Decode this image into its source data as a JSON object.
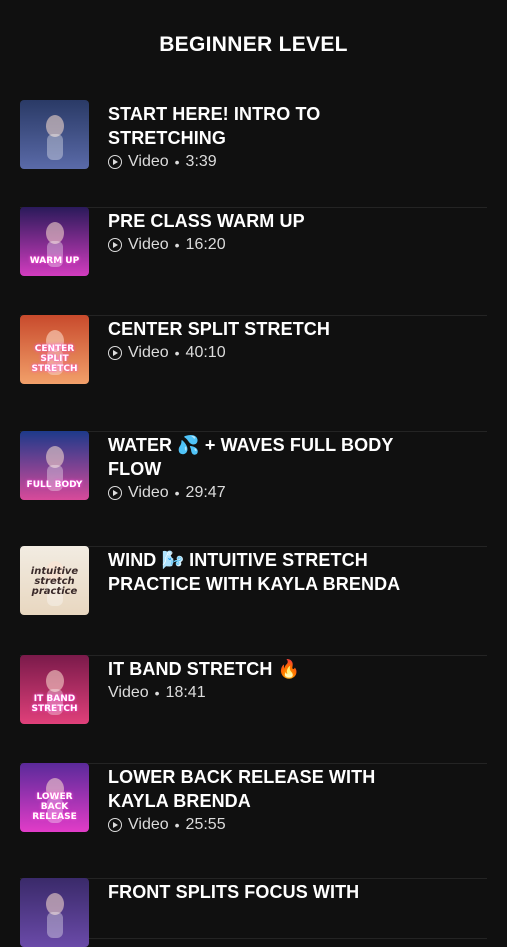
{
  "header": {
    "title": "BEGINNER LEVEL"
  },
  "items": [
    {
      "title": "START HERE! INTRO TO STRETCHING",
      "type": "Video",
      "duration": "3:39",
      "show_play": true,
      "thumb_text": "",
      "thumb_colors": [
        "#2a3a66",
        "#5a6aa8"
      ]
    },
    {
      "title": "PRE CLASS WARM UP",
      "type": "Video",
      "duration": "16:20",
      "show_play": true,
      "thumb_text": "WARM UP",
      "thumb_colors": [
        "#2a1a5a",
        "#d23cbf"
      ]
    },
    {
      "title": "CENTER SPLIT STRETCH",
      "type": "Video",
      "duration": "40:10",
      "show_play": true,
      "thumb_text": "CENTER SPLIT STRETCH",
      "thumb_colors": [
        "#c84a2c",
        "#f2a06a"
      ]
    },
    {
      "title": "WATER 💦 + WAVES FULL BODY FLOW",
      "type": "Video",
      "duration": "29:47",
      "show_play": true,
      "thumb_text": "FULL BODY",
      "thumb_colors": [
        "#1d3a8a",
        "#d84a9a"
      ]
    },
    {
      "title": "WIND 🌬️ INTUITIVE STRETCH PRACTICE WITH KAYLA BRENDA",
      "type": "",
      "duration": "",
      "show_play": false,
      "thumb_text": "intuitive stretch practice",
      "thumb_colors": [
        "#f2ece2",
        "#e8d7c0"
      ]
    },
    {
      "title": "IT BAND STRETCH 🔥",
      "type": "Video",
      "duration": "18:41",
      "show_play": false,
      "thumb_text": "IT BAND STRETCH",
      "thumb_colors": [
        "#7a1a4a",
        "#e0407a"
      ]
    },
    {
      "title": "LOWER BACK RELEASE WITH KAYLA BRENDA",
      "type": "Video",
      "duration": "25:55",
      "show_play": true,
      "thumb_text": "LOWER BACK RELEASE",
      "thumb_colors": [
        "#5a2a9a",
        "#e23cc8"
      ]
    },
    {
      "title": "FRONT SPLITS FOCUS WITH",
      "type": "",
      "duration": "",
      "show_play": false,
      "thumb_text": "",
      "thumb_colors": [
        "#3a2a6a",
        "#6a4aa8"
      ]
    }
  ]
}
